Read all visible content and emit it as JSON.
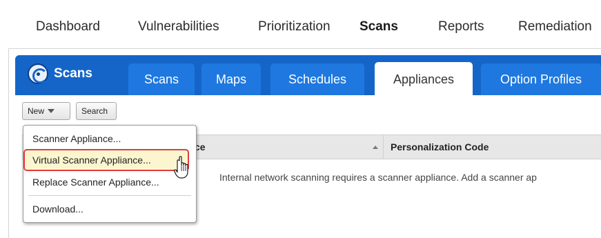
{
  "top_nav": {
    "items": [
      "Dashboard",
      "Vulnerabilities",
      "Prioritization",
      "Scans",
      "Reports",
      "Remediation"
    ],
    "active": "Scans"
  },
  "module": {
    "brand_label": "Scans",
    "tabs": [
      "Scans",
      "Maps",
      "Schedules",
      "Appliances",
      "Option Profiles"
    ],
    "selected_tab": "Appliances"
  },
  "toolbar": {
    "new_label": "New",
    "search_label": "Search"
  },
  "table": {
    "columns": [
      "ce",
      "Personalization Code"
    ],
    "empty_message": "Internal network scanning requires a scanner appliance. Add a scanner ap"
  },
  "new_menu": {
    "items": [
      "Scanner Appliance...",
      "Virtual Scanner Appliance...",
      "Replace Scanner Appliance...",
      "Download..."
    ],
    "highlighted": "Virtual Scanner Appliance..."
  },
  "colors": {
    "band": "#1565c8",
    "tab": "#1e78e0",
    "highlight_fill": "#fbf6cf",
    "highlight_border": "#e23b3b"
  }
}
